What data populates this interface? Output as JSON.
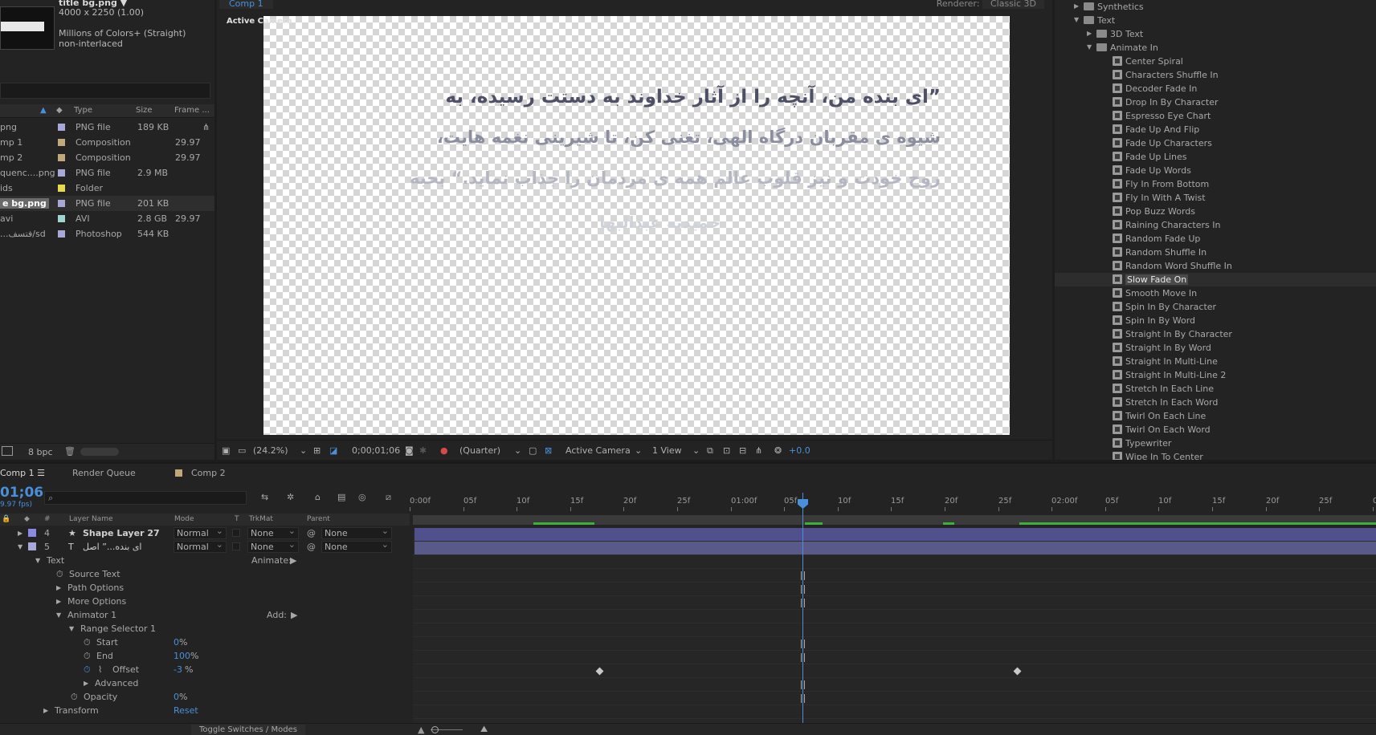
{
  "project": {
    "selected_name": "title bg.png",
    "selected_dims": "4000 x 2250 (1.00)",
    "selected_colors": "Millions of Colors+ (Straight)",
    "selected_interlace": "non-interlaced",
    "columns": {
      "type": "Type",
      "size": "Size",
      "frame": "Frame ..."
    },
    "items": [
      {
        "name": "png",
        "type": "PNG file",
        "size": "189 KB",
        "frame": "",
        "color": "#a7a7d8"
      },
      {
        "name": "mp 1",
        "type": "Composition",
        "size": "",
        "frame": "29.97",
        "color": "#c2a77a"
      },
      {
        "name": "mp 2",
        "type": "Composition",
        "size": "",
        "frame": "29.97",
        "color": "#c2a77a"
      },
      {
        "name": "quenc....png",
        "type": "PNG file",
        "size": "2.9 MB",
        "frame": "",
        "color": "#a7a7d8"
      },
      {
        "name": "ids",
        "type": "Folder",
        "size": "",
        "frame": "",
        "color": "#e6d84a"
      },
      {
        "name": "e bg.png",
        "type": "PNG file",
        "size": "201 KB",
        "frame": "",
        "color": "#a7a7d8"
      },
      {
        "name": "avi",
        "type": "AVI",
        "size": "2.8 GB",
        "frame": "29.97",
        "color": "#9fd4d0"
      },
      {
        "name": "...فتسف/sd",
        "type": "Photoshop",
        "size": "544 KB",
        "frame": "",
        "color": "#a7a7d8"
      }
    ],
    "bpc": "8 bpc"
  },
  "viewer": {
    "tab": "Comp 1",
    "renderer_label": "Renderer:",
    "renderer_value": "Classic 3D",
    "active_camera_label": "Active Camera",
    "text_lines": [
      "”ای بنده من، آنچه را از آثار خداوند به دستت رسیده، به",
      "شیوه ی مقربان درگاه الهی، تغنی کن، تا شیرینی نغمه هایت،",
      "روح خودت و نیز قلوب عالم همه ی مردمان را جذاب نماید.“ بحبه",
      "حمیدیه عبدالبها"
    ],
    "toolbar": {
      "zoom": "(24.2%)",
      "timecode": "0;00;01;06",
      "resolution": "(Quarter)",
      "camera": "Active Camera",
      "views": "1 View",
      "exposure": "+0.0"
    }
  },
  "effects": {
    "items": [
      {
        "label": "Synthetics",
        "kind": "folder",
        "depth": 1,
        "open": false
      },
      {
        "label": "Text",
        "kind": "folder",
        "depth": 1,
        "open": true
      },
      {
        "label": "3D Text",
        "kind": "folder",
        "depth": 2,
        "open": false
      },
      {
        "label": "Animate In",
        "kind": "folder",
        "depth": 2,
        "open": true
      },
      {
        "label": "Center Spiral",
        "kind": "preset",
        "depth": 3
      },
      {
        "label": "Characters Shuffle In",
        "kind": "preset",
        "depth": 3
      },
      {
        "label": "Decoder Fade In",
        "kind": "preset",
        "depth": 3
      },
      {
        "label": "Drop In By Character",
        "kind": "preset",
        "depth": 3
      },
      {
        "label": "Espresso Eye Chart",
        "kind": "preset",
        "depth": 3
      },
      {
        "label": "Fade Up And Flip",
        "kind": "preset",
        "depth": 3
      },
      {
        "label": "Fade Up Characters",
        "kind": "preset",
        "depth": 3
      },
      {
        "label": "Fade Up Lines",
        "kind": "preset",
        "depth": 3
      },
      {
        "label": "Fade Up Words",
        "kind": "preset",
        "depth": 3
      },
      {
        "label": "Fly In From Bottom",
        "kind": "preset",
        "depth": 3
      },
      {
        "label": "Fly In With A Twist",
        "kind": "preset",
        "depth": 3
      },
      {
        "label": "Pop Buzz Words",
        "kind": "preset",
        "depth": 3
      },
      {
        "label": "Raining Characters In",
        "kind": "preset",
        "depth": 3
      },
      {
        "label": "Random Fade Up",
        "kind": "preset",
        "depth": 3
      },
      {
        "label": "Random Shuffle In",
        "kind": "preset",
        "depth": 3
      },
      {
        "label": "Random Word Shuffle In",
        "kind": "preset",
        "depth": 3
      },
      {
        "label": "Slow Fade On",
        "kind": "preset",
        "depth": 3,
        "selected": true
      },
      {
        "label": "Smooth Move In",
        "kind": "preset",
        "depth": 3
      },
      {
        "label": "Spin In By Character",
        "kind": "preset",
        "depth": 3
      },
      {
        "label": "Spin In By Word",
        "kind": "preset",
        "depth": 3
      },
      {
        "label": "Straight In By Character",
        "kind": "preset",
        "depth": 3
      },
      {
        "label": "Straight In By Word",
        "kind": "preset",
        "depth": 3
      },
      {
        "label": "Straight In Multi-Line",
        "kind": "preset",
        "depth": 3
      },
      {
        "label": "Straight In Multi-Line 2",
        "kind": "preset",
        "depth": 3
      },
      {
        "label": "Stretch In Each Line",
        "kind": "preset",
        "depth": 3
      },
      {
        "label": "Stretch In Each Word",
        "kind": "preset",
        "depth": 3
      },
      {
        "label": "Twirl On Each Line",
        "kind": "preset",
        "depth": 3
      },
      {
        "label": "Twirl On Each Word",
        "kind": "preset",
        "depth": 3
      },
      {
        "label": "Typewriter",
        "kind": "preset",
        "depth": 3
      },
      {
        "label": "Wipe In To Center",
        "kind": "preset",
        "depth": 3
      }
    ]
  },
  "timeline": {
    "tabs": [
      "Comp 1",
      "Render Queue",
      "Comp 2"
    ],
    "timecode": "01;06",
    "fps": "9.97 fps)",
    "columns": {
      "num": "#",
      "layer_name": "Layer Name",
      "mode": "Mode",
      "t": "T",
      "trkmat": "TrkMat",
      "parent": "Parent"
    },
    "layers": [
      {
        "num": "4",
        "name": "Shape Layer 27",
        "mode": "Normal",
        "trkmat": "None",
        "parent": "None",
        "color": "#8a8ae6"
      },
      {
        "num": "5",
        "name": "ای بنده...”   اصل",
        "mode": "Normal",
        "trkmat": "None",
        "parent": "None",
        "color": "#a7a7d8"
      }
    ],
    "props": [
      {
        "label": "Text",
        "indent": 44,
        "twirl": "▼",
        "extra_label": "Animate:"
      },
      {
        "label": "Source Text",
        "indent": 86,
        "stopwatch": true
      },
      {
        "label": "Path Options",
        "indent": 70,
        "twirl": "▶"
      },
      {
        "label": "More Options",
        "indent": 70,
        "twirl": "▶"
      },
      {
        "label": "Animator 1",
        "indent": 70,
        "twirl": "▼",
        "extra_label": "Add:"
      },
      {
        "label": "Range Selector 1",
        "indent": 86,
        "twirl": "▼"
      },
      {
        "label": "Start",
        "indent": 120,
        "stopwatch": true,
        "value": "0",
        "unit": "%"
      },
      {
        "label": "End",
        "indent": 120,
        "stopwatch": true,
        "value": "100",
        "unit": "%"
      },
      {
        "label": "Offset",
        "indent": 140,
        "stopwatch": true,
        "active": true,
        "value": "-3",
        "unit": "%"
      },
      {
        "label": "Advanced",
        "indent": 104,
        "twirl": "▶"
      },
      {
        "label": "Opacity",
        "indent": 104,
        "stopwatch": true,
        "value": "0",
        "unit": "%"
      },
      {
        "label": "Transform",
        "indent": 54,
        "twirl": "▶",
        "value": "Reset"
      }
    ],
    "ruler": [
      "0:00f",
      "05f",
      "10f",
      "15f",
      "20f",
      "25f",
      "01:00f",
      "05f",
      "10f",
      "15f",
      "20f",
      "25f",
      "02:00f",
      "05f",
      "10f",
      "15f",
      "20f",
      "25f",
      "0"
    ],
    "toggle_label": "Toggle Switches / Modes"
  },
  "colors": {
    "accent": "#4a8fd9",
    "bg": "#232323",
    "bar": "#5a5a9a"
  }
}
